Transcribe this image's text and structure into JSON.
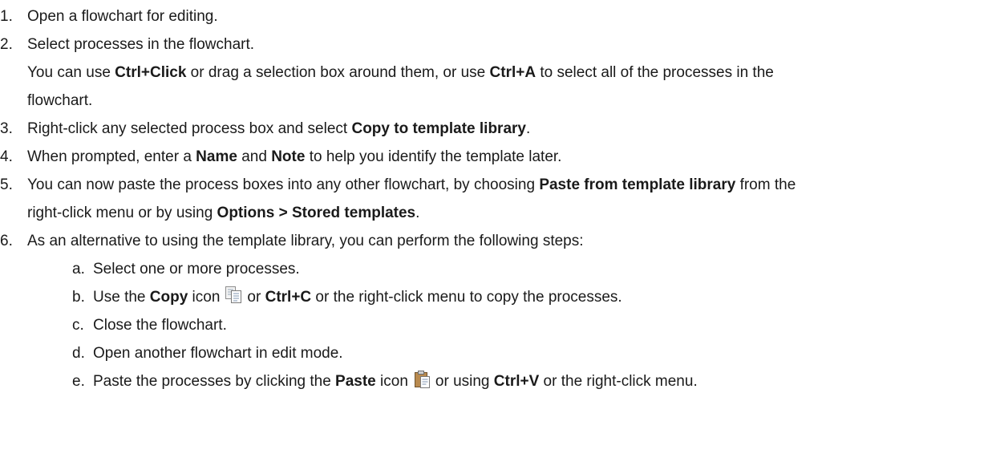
{
  "steps": [
    {
      "num": "1.",
      "text": "Open a flowchart for editing."
    },
    {
      "num": "2.",
      "text": "Select processes in the flowchart.",
      "note": {
        "t1": "You can use ",
        "b1": "Ctrl+Click",
        "t2": " or drag a selection box around them, or use ",
        "b2": "Ctrl+A",
        "t3": " to select all of the processes in the",
        "t4": "flowchart."
      }
    },
    {
      "num": "3.",
      "t1": "Right-click any selected process box and select ",
      "b1": "Copy to template library",
      "t2": "."
    },
    {
      "num": "4.",
      "t1": "When prompted, enter a ",
      "b1": "Name",
      "t2": " and ",
      "b2": "Note",
      "t3": " to help you identify the template later."
    },
    {
      "num": "5.",
      "t1": "You can now paste the process boxes into any other flowchart, by choosing ",
      "b1": "Paste from template library",
      "t2": " from the",
      "t3": "right-click menu or by using ",
      "b2": "Options > Stored templates",
      "t4": "."
    },
    {
      "num": "6.",
      "text": "As an alternative to using the template library, you can perform the following steps:",
      "substeps": [
        {
          "letter": "a.",
          "text": "Select one or more processes."
        },
        {
          "letter": "b.",
          "t1": "Use the ",
          "b1": "Copy",
          "t2": " icon",
          "icon": "copy-icon",
          "t3": "or ",
          "b2": "Ctrl+C",
          "t4": " or the right-click menu to copy the processes."
        },
        {
          "letter": "c.",
          "text": "Close the flowchart."
        },
        {
          "letter": "d.",
          "text": "Open another flowchart in edit mode."
        },
        {
          "letter": "e.",
          "t1": "Paste the processes by clicking the ",
          "b1": "Paste",
          "t2": " icon",
          "icon": "paste-icon",
          "t3": "or using ",
          "b2": "Ctrl+V",
          "t4": " or the right-click menu."
        }
      ]
    }
  ]
}
